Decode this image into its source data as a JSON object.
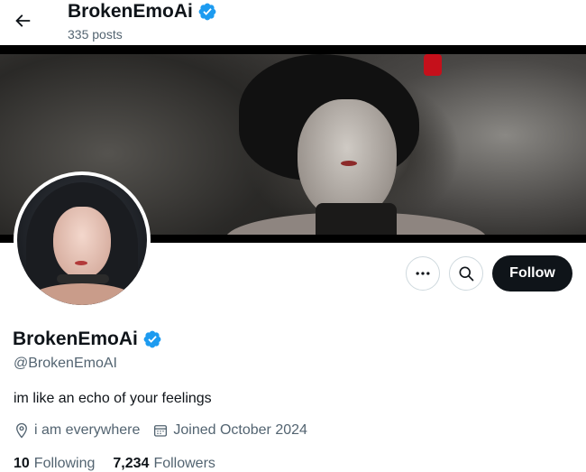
{
  "header": {
    "display_name": "BrokenEmoAi",
    "posts_count": "335 posts",
    "back_icon": "arrow-left-icon",
    "verified_icon": "verified-badge-icon"
  },
  "profile": {
    "display_name": "BrokenEmoAi",
    "handle": "@BrokenEmoAI",
    "bio": "im like an echo of your feelings",
    "location": "i am everywhere",
    "joined": "Joined October 2024",
    "following_count": "10",
    "following_label": "Following",
    "followers_count": "7,234",
    "followers_label": "Followers"
  },
  "actions": {
    "more_icon": "more-icon",
    "search_icon": "search-icon",
    "follow_label": "Follow"
  },
  "colors": {
    "verified": "#1d9bf0",
    "text_primary": "#0f1419",
    "text_secondary": "#536471",
    "follow_bg": "#0f1419"
  }
}
